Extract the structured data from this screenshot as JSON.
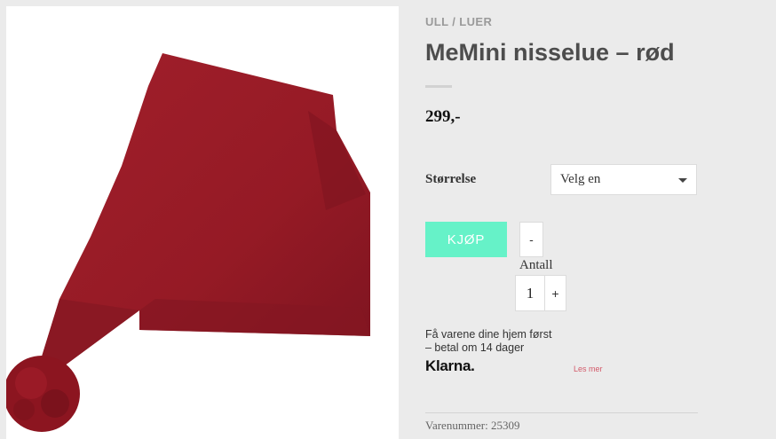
{
  "product": {
    "image_alt": "Red knitted Santa hat with pompom",
    "colors": {
      "hat": "#9b1b26",
      "hat_shadow": "#7e1420",
      "hat_dark": "#6a0f18"
    }
  },
  "breadcrumb": {
    "category": "ULL",
    "separator": " / ",
    "subcategory": "LUER"
  },
  "title": "MeMini nisselue – rød",
  "price": "299,-",
  "variation": {
    "label": "Størrelse",
    "selected": "Velg en"
  },
  "cart": {
    "buy_label": "KJØP",
    "minus_label": "-",
    "quantity_label": "Antall",
    "quantity_value": "1",
    "plus_label": "+"
  },
  "klarna": {
    "text_line1": "Få varene dine hjem først",
    "text_line2": "– betal om 14 dager",
    "logo": "Klarna.",
    "read_more": "Les mer"
  },
  "meta": {
    "sku_label": "Varenummer:",
    "sku_value": "25309"
  },
  "theme": {
    "accent": "#66f2c8",
    "link": "#d35a6a",
    "background": "#ebebeb"
  }
}
